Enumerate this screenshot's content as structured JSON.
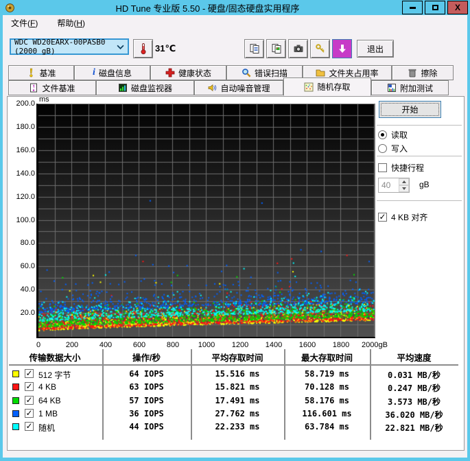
{
  "window": {
    "title": "HD Tune 专业版 5.50 - 硬盘/固态硬盘实用程序",
    "controls": {
      "close_label": "X"
    }
  },
  "menu": {
    "file": {
      "pre": "文件(",
      "key": "F",
      "suf": ")"
    },
    "help": {
      "pre": "帮助(",
      "key": "H",
      "suf": ")"
    }
  },
  "toolbar": {
    "drive_select": "WDC WD20EARX-00PASB0 (2000 gB)",
    "temperature": "31℃",
    "exit_label": "退出"
  },
  "tabs": {
    "row1": [
      {
        "label": "基准"
      },
      {
        "label": "磁盘信息"
      },
      {
        "label": "健康状态"
      },
      {
        "label": "错误扫描"
      },
      {
        "label": "文件夹占用率"
      },
      {
        "label": "擦除"
      }
    ],
    "row2": [
      {
        "label": "文件基准"
      },
      {
        "label": "磁盘监视器"
      },
      {
        "label": "自动噪音管理"
      },
      {
        "label": "随机存取"
      },
      {
        "label": "附加测试"
      }
    ],
    "active": "随机存取"
  },
  "controls": {
    "start": "开始",
    "read": "读取",
    "write": "写入",
    "short_stroke": "快捷行程",
    "capacity_value": "40",
    "capacity_unit": "gB",
    "align_4kb": "4 KB 对齐"
  },
  "chart_data": {
    "type": "scatter",
    "title": "随机存取 latency vs disk position",
    "x_unit": "gB",
    "y_unit": "ms",
    "xlim": [
      0,
      2000
    ],
    "ylim": [
      0,
      200
    ],
    "x_ticks": [
      0,
      200,
      400,
      600,
      800,
      1000,
      1200,
      1400,
      1600,
      1800,
      2000
    ],
    "x_tick_labels": [
      "0",
      "200",
      "400",
      "600",
      "800",
      "1000",
      "1200",
      "1400",
      "1600",
      "1800",
      "2000gB"
    ],
    "y_ticks": [
      20,
      40,
      60,
      80,
      100,
      120,
      140,
      160,
      180,
      200
    ],
    "grid": {
      "x_step": 100,
      "y_step": 10,
      "color": "#6E6E6E"
    },
    "background": {
      "top": "#020202",
      "bottom": "#505050"
    },
    "floor": {
      "start": 4,
      "end": 13,
      "power": 0.75
    },
    "series": [
      {
        "name": "512 字节",
        "color": "#FFFF00",
        "count": 1000,
        "base": 1,
        "scale": 5,
        "cap": 16,
        "outliers": 6,
        "outlier_range": [
          35,
          58
        ],
        "iops": 64,
        "avg_ms": 15.516,
        "max_ms": 58.719,
        "avg_speed_mb_s": 0.031
      },
      {
        "name": "4 KB",
        "color": "#FF1414",
        "count": 1000,
        "base": 1.5,
        "scale": 5.5,
        "cap": 18,
        "outliers": 8,
        "outlier_range": [
          35,
          70
        ],
        "iops": 63,
        "avg_ms": 15.821,
        "max_ms": 70.128,
        "avg_speed_mb_s": 0.247
      },
      {
        "name": "64 KB",
        "color": "#00DC00",
        "count": 900,
        "base": 4,
        "scale": 5,
        "cap": 18,
        "outliers": 8,
        "outlier_range": [
          35,
          58
        ],
        "iops": 57,
        "avg_ms": 17.491,
        "max_ms": 58.176,
        "avg_speed_mb_s": 3.573
      },
      {
        "name": "1 MB",
        "color": "#0060FF",
        "count": 650,
        "base": 16,
        "scale": 6,
        "cap": 26,
        "outliers": 14,
        "outlier_range": [
          45,
          75
        ],
        "extremes": [
          [
            665,
            117
          ],
          [
            1330,
            115
          ]
        ],
        "iops": 36,
        "avg_ms": 27.762,
        "max_ms": 116.601,
        "avg_speed_mb_s": 36.02
      },
      {
        "name": "随机",
        "color": "#00FFFF",
        "count": 700,
        "base": 9,
        "scale": 5,
        "cap": 20,
        "outliers": 6,
        "outlier_range": [
          38,
          64
        ],
        "iops": 44,
        "avg_ms": 22.233,
        "max_ms": 63.784,
        "avg_speed_mb_s": 22.821
      }
    ]
  },
  "table": {
    "headers": [
      "传输数据大小",
      "操作/秒",
      "平均存取时间",
      "最大存取时间",
      "平均速度"
    ],
    "rows": [
      {
        "color": "#FFFF00",
        "label": "512 字节",
        "iops": "64 IOPS",
        "avg": "15.516 ms",
        "max": "58.719 ms",
        "speed": "0.031 MB/秒"
      },
      {
        "color": "#FF1414",
        "label": "4 KB",
        "iops": "63 IOPS",
        "avg": "15.821 ms",
        "max": "70.128 ms",
        "speed": "0.247 MB/秒"
      },
      {
        "color": "#00DC00",
        "label": "64 KB",
        "iops": "57 IOPS",
        "avg": "17.491 ms",
        "max": "58.176 ms",
        "speed": "3.573 MB/秒"
      },
      {
        "color": "#0060FF",
        "label": "1 MB",
        "iops": "36 IOPS",
        "avg": "27.762 ms",
        "max": "116.601 ms",
        "speed": "36.020 MB/秒"
      },
      {
        "color": "#00FFFF",
        "label": "随机",
        "iops": "44 IOPS",
        "avg": "22.233 ms",
        "max": "63.784 ms",
        "speed": "22.821 MB/秒"
      }
    ]
  }
}
